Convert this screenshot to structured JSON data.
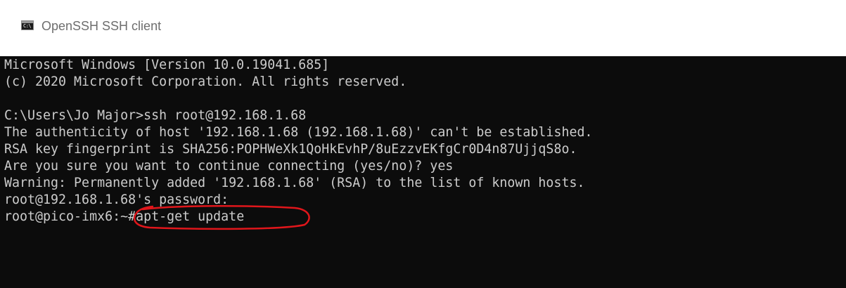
{
  "window": {
    "title": "OpenSSH SSH client",
    "icon": "console-app-icon"
  },
  "console": {
    "lines": [
      "Microsoft Windows [Version 10.0.19041.685]",
      "(c) 2020 Microsoft Corporation. All rights reserved.",
      "",
      "C:\\Users\\Jo Major>ssh root@192.168.1.68",
      "The authenticity of host '192.168.1.68 (192.168.1.68)' can't be established.",
      "RSA key fingerprint is SHA256:POPHWeXk1QoHkEvhP/8uEzzvEKfgCr0D4n87UjjqS8o.",
      "Are you sure you want to continue connecting (yes/no)? yes",
      "Warning: Permanently added '192.168.1.68' (RSA) to the list of known hosts.",
      "root@192.168.1.68's password:"
    ],
    "prompt": "root@pico-imx6:~#",
    "command": "apt-get update",
    "colors": {
      "background": "#0c0c0c",
      "text": "#cccccc",
      "annotation": "#e0161b"
    }
  }
}
